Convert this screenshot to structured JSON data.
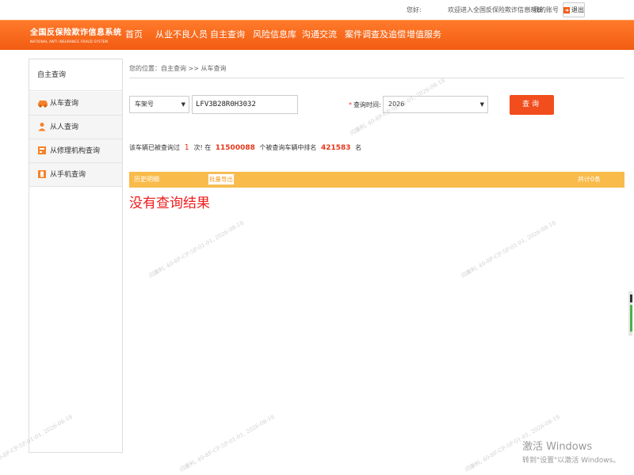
{
  "top_bar": {
    "greeting": "您好:",
    "welcome": "欢迎进入全国反保险欺诈信息系统",
    "separator": "|",
    "my_account": "我的账号",
    "logout": "退出"
  },
  "logo": {
    "cn": "全国反保险欺诈信息系统",
    "en": "NATIONAL ANTI INSURANCE FRAUD SYSTEM"
  },
  "nav": {
    "items": [
      "首页",
      "从业不良人员",
      "自主查询",
      "风险信息库",
      "沟通交流",
      "案件调查及追偿",
      "增值服务"
    ]
  },
  "sidebar": {
    "header": "自主查询",
    "items": [
      {
        "label": "从车查询",
        "icon": "car-icon"
      },
      {
        "label": "从人查询",
        "icon": "person-icon"
      },
      {
        "label": "从修理机构查询",
        "icon": "repair-shop-icon"
      },
      {
        "label": "从手机查询",
        "icon": "phone-icon"
      }
    ]
  },
  "breadcrumb": {
    "text": "您的位置：自主查询 >> 从车查询"
  },
  "query_form": {
    "type_value": "车架号",
    "vin_value": "LFV3B28R0H3032",
    "time_label": "查询时间:",
    "required_mark": "*",
    "year_value": "2026",
    "submit": "查询"
  },
  "stats": {
    "prefix": "该车辆已被查询过",
    "count": "1",
    "mid1": "次! 在",
    "total": "11500088",
    "mid2": "个被查询车辆中排名",
    "rank": "421583",
    "suffix": "名"
  },
  "results": {
    "history_label": "历史明细",
    "export_label": "批量导出",
    "total_label": "共计0条",
    "no_result": "没有查询结果"
  },
  "watermark": {
    "text": "闫康利, 40-8F-CF-5F-01-01, 2026-08-18"
  },
  "windows_activation": {
    "title": "激活 Windows",
    "subtitle": "转到\"设置\"以激活 Windows。"
  },
  "colors": {
    "nav_orange": "#f25c12",
    "button_red": "#f24d1d",
    "results_bar": "#f9bb4a",
    "no_result_red": "#ee1c1c"
  }
}
